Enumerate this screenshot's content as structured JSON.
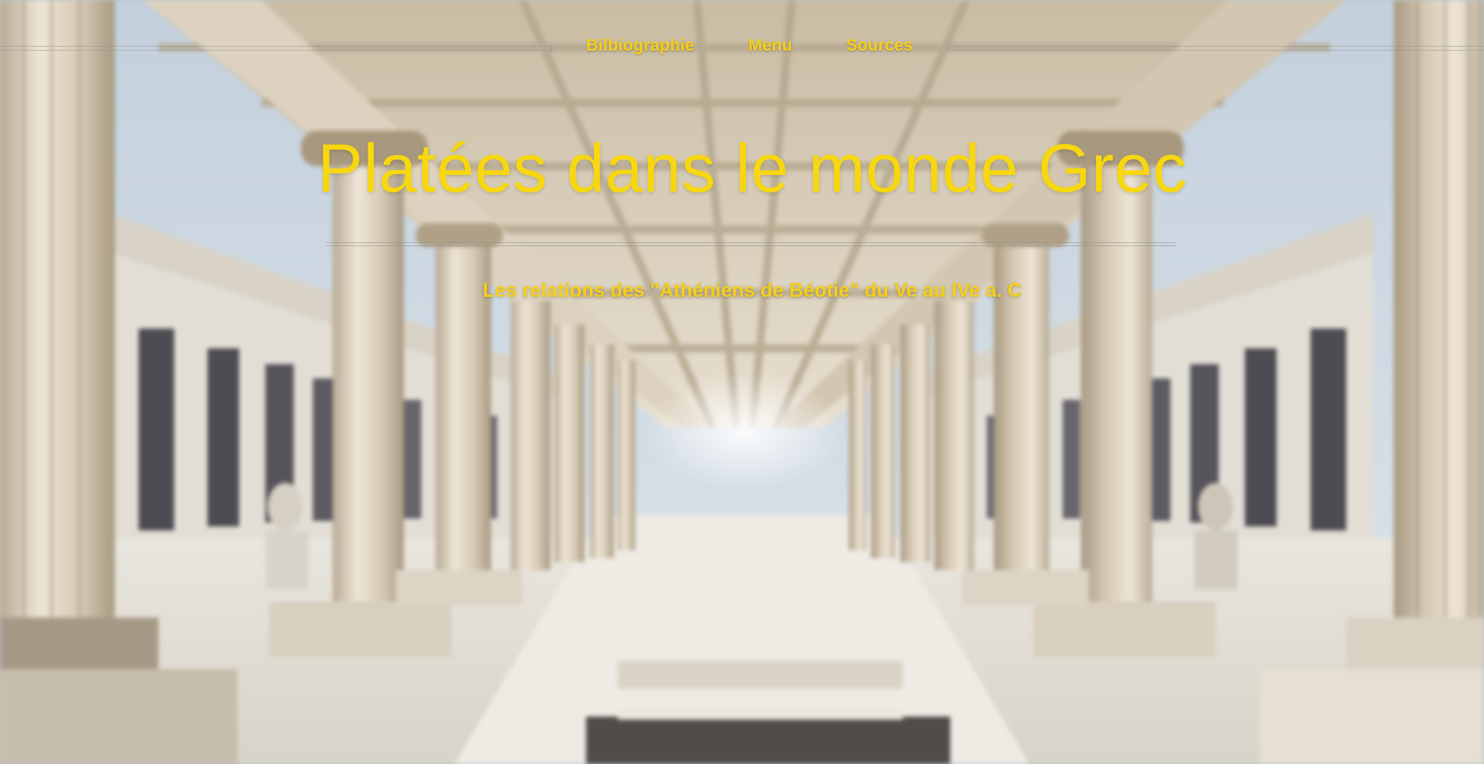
{
  "nav": {
    "items": [
      {
        "label": "Bilbiographie"
      },
      {
        "label": "Menu"
      },
      {
        "label": "Sources"
      }
    ]
  },
  "hero": {
    "title": "Platées dans le monde Grec",
    "subtitle": "Les relations des \"Athéniens de Béotie\" du Ve au IVe a. C"
  },
  "colors": {
    "accent": "#f5cf18",
    "stone": "#e6dccb",
    "sky": "#c7d4e0"
  }
}
